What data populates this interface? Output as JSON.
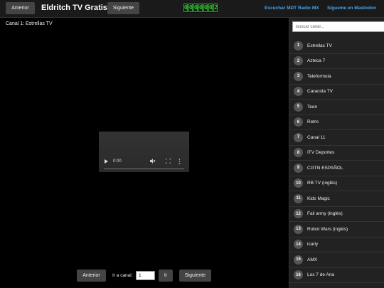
{
  "header": {
    "prev_label": "Anterior",
    "title": "Eldritch TV Gratis",
    "next_label": "Siguiente",
    "visitor_counter": [
      "0",
      "0",
      "0",
      "0",
      "0",
      "0",
      "2"
    ],
    "radio_link": "Escuchar MDT Radio MX",
    "mastodon_link": "Sígueme en Mastodon"
  },
  "player": {
    "now_playing": "Canal 1: Estrellas TV",
    "time": "0:00"
  },
  "controls": {
    "prev_label": "Anterior",
    "goto_label": "Ir a canal:",
    "goto_value": "1",
    "go_label": "Ir",
    "next_label": "Siguiente"
  },
  "sidebar": {
    "search_placeholder": "Buscar canal...",
    "channels": [
      {
        "num": "1",
        "name": "Estrellas TV"
      },
      {
        "num": "2",
        "name": "Azteca 7"
      },
      {
        "num": "3",
        "name": "Teleformula"
      },
      {
        "num": "4",
        "name": "Caracola TV"
      },
      {
        "num": "5",
        "name": "Teen"
      },
      {
        "num": "6",
        "name": "Retro"
      },
      {
        "num": "7",
        "name": "Canal 11"
      },
      {
        "num": "8",
        "name": "ITV Deportes"
      },
      {
        "num": "9",
        "name": "CGTN ESPAÑOL"
      },
      {
        "num": "10",
        "name": "RB TV (inglés)"
      },
      {
        "num": "11",
        "name": "Kids Magic"
      },
      {
        "num": "12",
        "name": "Fail army (inglés)"
      },
      {
        "num": "13",
        "name": "Robot Wars (inglés)"
      },
      {
        "num": "14",
        "name": "icarly"
      },
      {
        "num": "15",
        "name": "AMX"
      },
      {
        "num": "16",
        "name": "Los 7 de Ana"
      }
    ]
  },
  "colors": {
    "link": "#4aa3e8",
    "counter_digit": "#44ff44",
    "button_bg": "#444444",
    "sidebar_bg": "#222222"
  }
}
